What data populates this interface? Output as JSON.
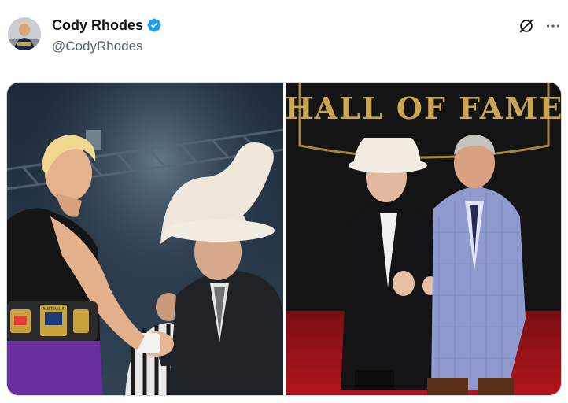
{
  "author": {
    "display_name": "Cody Rhodes",
    "handle": "@CodyRhodes",
    "verified": true,
    "avatar_icon": "avatar"
  },
  "actions": {
    "grok_icon": "grok-icon",
    "more_icon": "more-options-icon"
  },
  "media": {
    "photo_count": 2,
    "photo_left": {
      "belt_plate_text": "AUSTRALIA"
    },
    "photo_right": {
      "backdrop_text": "HALL OF FAME"
    }
  },
  "colors": {
    "verified_blue": "#1d9bf0",
    "handle_gray": "#536471",
    "border": "#cfd9de"
  }
}
